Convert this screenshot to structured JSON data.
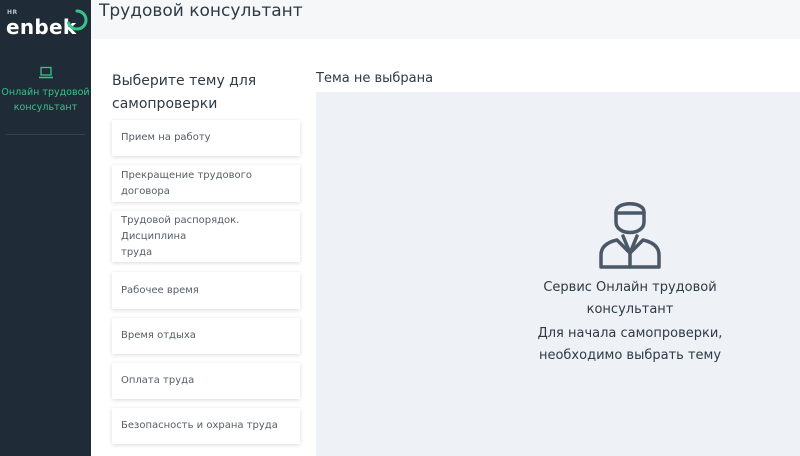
{
  "brand": {
    "prefix": "HR",
    "name": "enbek",
    "accent_color": "#35c58a"
  },
  "sidebar": {
    "items": [
      {
        "label_line1": "Онлайн трудовой",
        "label_line2": "консультант",
        "icon": "laptop-icon"
      }
    ]
  },
  "header": {
    "title": "Трудовой консультант"
  },
  "topics": {
    "title_line1": "Выберите тему для",
    "title_line2": "самопроверки",
    "items": [
      {
        "label": "Прием на работу"
      },
      {
        "label": "Прекращение трудового договора"
      },
      {
        "label_line1": "Трудовой распорядок. Дисциплина",
        "label_line2": "труда"
      },
      {
        "label": "Рабочее время"
      },
      {
        "label": "Время отдыха"
      },
      {
        "label": "Оплата труда"
      },
      {
        "label": "Безопасность и охрана труда"
      }
    ]
  },
  "content": {
    "title": "Тема не выбрана",
    "icon": "consultant-avatar-icon",
    "message_line1": "Сервис Онлайн трудовой",
    "message_line2": "консультант",
    "message_line3": "Для начала самопроверки,",
    "message_line4": "необходимо выбрать тему"
  }
}
